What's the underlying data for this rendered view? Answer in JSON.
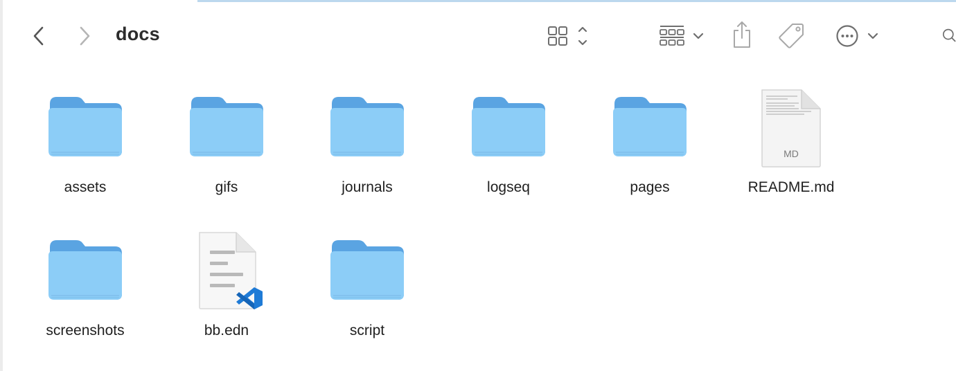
{
  "window": {
    "title": "docs"
  },
  "toolbar": {
    "buttons": [
      {
        "name": "back",
        "icon": "chevron-left-icon"
      },
      {
        "name": "forward",
        "icon": "chevron-right-icon"
      },
      {
        "name": "view-mode",
        "icon": "icon-grid-icon"
      },
      {
        "name": "group-by",
        "icon": "group-grid-icon"
      },
      {
        "name": "share",
        "icon": "share-icon"
      },
      {
        "name": "tags",
        "icon": "tag-icon"
      },
      {
        "name": "more",
        "icon": "ellipsis-circle-icon"
      },
      {
        "name": "search",
        "icon": "search-icon"
      }
    ]
  },
  "items": [
    {
      "label": "assets",
      "kind": "folder"
    },
    {
      "label": "gifs",
      "kind": "folder"
    },
    {
      "label": "journals",
      "kind": "folder"
    },
    {
      "label": "logseq",
      "kind": "folder"
    },
    {
      "label": "pages",
      "kind": "folder"
    },
    {
      "label": "README.md",
      "kind": "markdown",
      "badge": "MD"
    },
    {
      "label": "screenshots",
      "kind": "folder"
    },
    {
      "label": "bb.edn",
      "kind": "vscode-doc"
    },
    {
      "label": "script",
      "kind": "folder"
    }
  ],
  "colors": {
    "folder_back": "#5aa4e2",
    "folder_front": "#8ccdf7",
    "icon_gray": "#7a7a7a",
    "vscode_blue": "#1f7bd6"
  }
}
